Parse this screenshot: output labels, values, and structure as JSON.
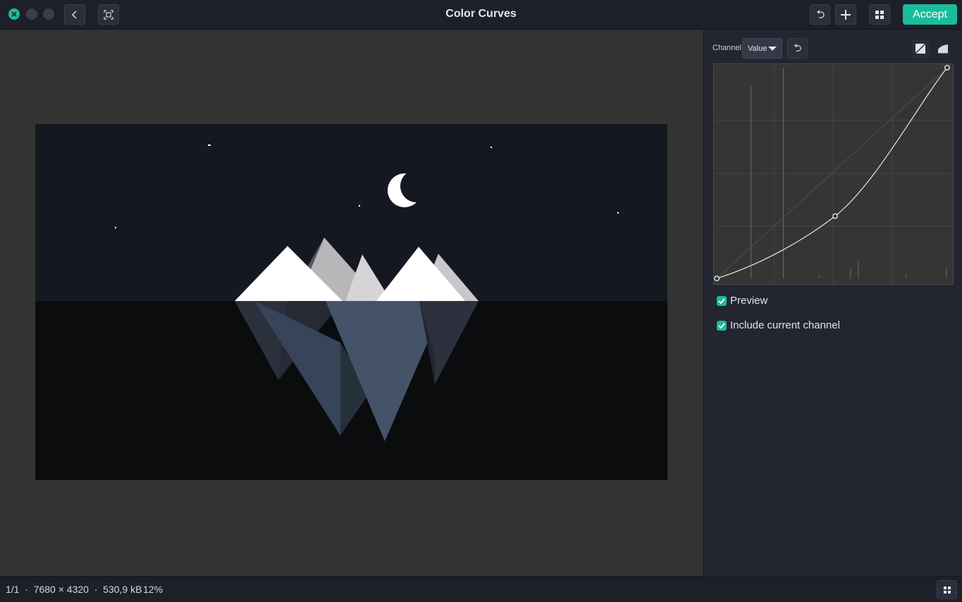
{
  "window": {
    "title": "Color Curves",
    "accept_label": "Accept",
    "close_color": "#1abc9c"
  },
  "sidebar": {
    "channel_label": "Channel:",
    "channel_value": "Value",
    "preview_label": "Preview",
    "preview_checked": true,
    "include_label": "Include current channel",
    "include_checked": true,
    "curve_mode_active": "linear"
  },
  "curve": {
    "control_points": [
      [
        0,
        0
      ],
      [
        0.5,
        0.3
      ],
      [
        1,
        1
      ]
    ]
  },
  "status": {
    "image_info": "1/1  ·  7680 × 4320  ·  530,9 kB",
    "zoom": "12%"
  },
  "colors": {
    "accent": "#1abc9c",
    "sky": "#151821",
    "water": "#0b0c0e"
  },
  "icons": [
    "close-icon",
    "back-icon",
    "fit-screen-icon",
    "undo-icon",
    "plus-icon",
    "grid-icon",
    "caret-down-icon",
    "reset-icon",
    "linear-curve-icon",
    "smooth-curve-icon",
    "check-icon",
    "layout-icon",
    "moon-icon"
  ]
}
